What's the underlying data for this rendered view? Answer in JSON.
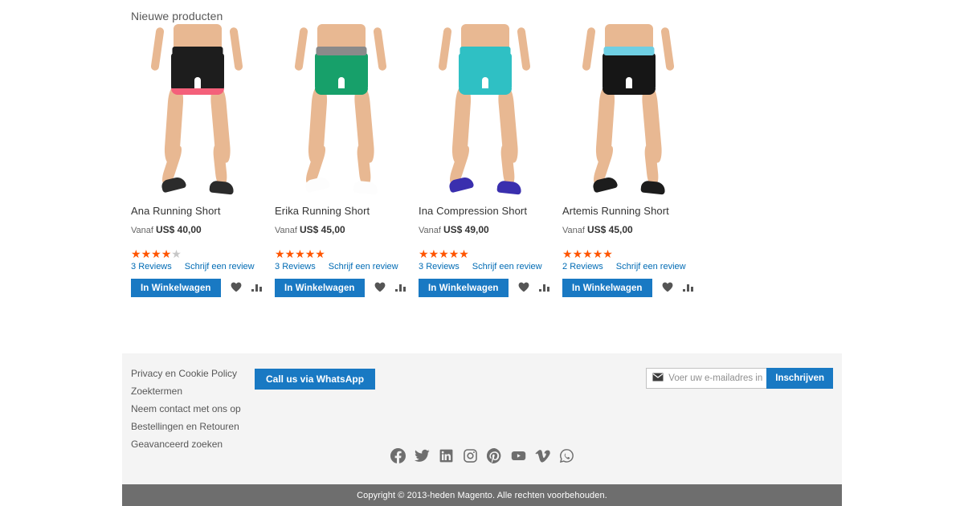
{
  "section": {
    "title": "Nieuwe producten"
  },
  "products": [
    {
      "name": "Ana Running Short",
      "price_prefix": "Vanaf",
      "price": "US$ 40,00",
      "rating": 4,
      "stars_total": 5,
      "review_count": "3",
      "review_label": "Reviews",
      "write_review": "Schrijf een review",
      "cart_label": "In Winkelwagen",
      "colors": {
        "shorts": "#1d1d1d",
        "waistband": "#1d1d1d",
        "hem": "#f4607a",
        "shoe": "#2b2b2b"
      }
    },
    {
      "name": "Erika Running Short",
      "price_prefix": "Vanaf",
      "price": "US$ 45,00",
      "rating": 5,
      "stars_total": 5,
      "review_count": "3",
      "review_label": "Reviews",
      "write_review": "Schrijf een review",
      "cart_label": "In Winkelwagen",
      "colors": {
        "shorts": "#17a06a",
        "waistband": "#8a8a8a",
        "hem": "#17a06a",
        "shoe": "#fdfdfd"
      }
    },
    {
      "name": "Ina Compression Short",
      "price_prefix": "Vanaf",
      "price": "US$ 49,00",
      "rating": 5,
      "stars_total": 5,
      "review_count": "3",
      "review_label": "Reviews",
      "write_review": "Schrijf een review",
      "cart_label": "In Winkelwagen",
      "colors": {
        "shorts": "#2fc0c4",
        "waistband": "#2fc0c4",
        "hem": "#2fc0c4",
        "shoe": "#3a2fae"
      }
    },
    {
      "name": "Artemis Running Short",
      "price_prefix": "Vanaf",
      "price": "US$ 45,00",
      "rating": 5,
      "stars_total": 5,
      "review_count": "2",
      "review_label": "Reviews",
      "write_review": "Schrijf een review",
      "cart_label": "In Winkelwagen",
      "colors": {
        "shorts": "#161616",
        "waistband": "#6fcfe3",
        "hem": "#161616",
        "shoe": "#1c1c1c"
      }
    }
  ],
  "footer": {
    "links": [
      "Privacy en Cookie Policy",
      "Zoektermen",
      "Neem contact met ons op",
      "Bestellingen en Retouren",
      "Geavanceerd zoeken"
    ],
    "whatsapp_label": "Call us via WhatsApp",
    "newsletter": {
      "placeholder": "Voer uw e-mailadres in",
      "value": "",
      "subscribe_label": "Inschrijven"
    },
    "social": [
      "facebook-icon",
      "twitter-icon",
      "linkedin-icon",
      "instagram-icon",
      "pinterest-icon",
      "youtube-icon",
      "vimeo-icon",
      "whatsapp-icon"
    ]
  },
  "copyright": "Copyright © 2013-heden Magento. Alle rechten voorbehouden.",
  "colors": {
    "accent_blue": "#1979c3",
    "link_blue": "#006bb4",
    "star_on": "#ff5501",
    "star_off": "#c7c7c7",
    "footer_bg": "#f4f4f4",
    "copyright_bg": "#6e6e6e"
  }
}
